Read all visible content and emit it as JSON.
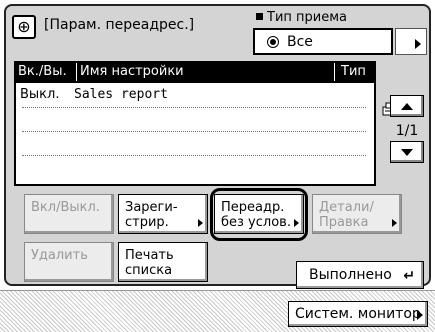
{
  "header": {
    "title": "[Парам. переадрес.]",
    "receive_type_label": "Тип приема",
    "receive_type_value": "Все"
  },
  "list": {
    "columns": [
      "Вк./Вы.",
      "Имя настройки",
      "Тип"
    ],
    "rows": [
      {
        "state": "Выкл.",
        "name": "Sales report",
        "type_icon": "fax-icon"
      }
    ],
    "page": "1/1"
  },
  "buttons": {
    "on_off": "Вкл/Выкл.",
    "register": "Зареги-\nстрир.",
    "forward_unconditional": "Переадр.\nбез услов.",
    "details": "Детали/\nПравка",
    "delete": "Удалить",
    "print_list": "Печать\nсписка",
    "done": "Выполнено"
  },
  "footer": {
    "system_monitor": "Систем. монитор"
  }
}
